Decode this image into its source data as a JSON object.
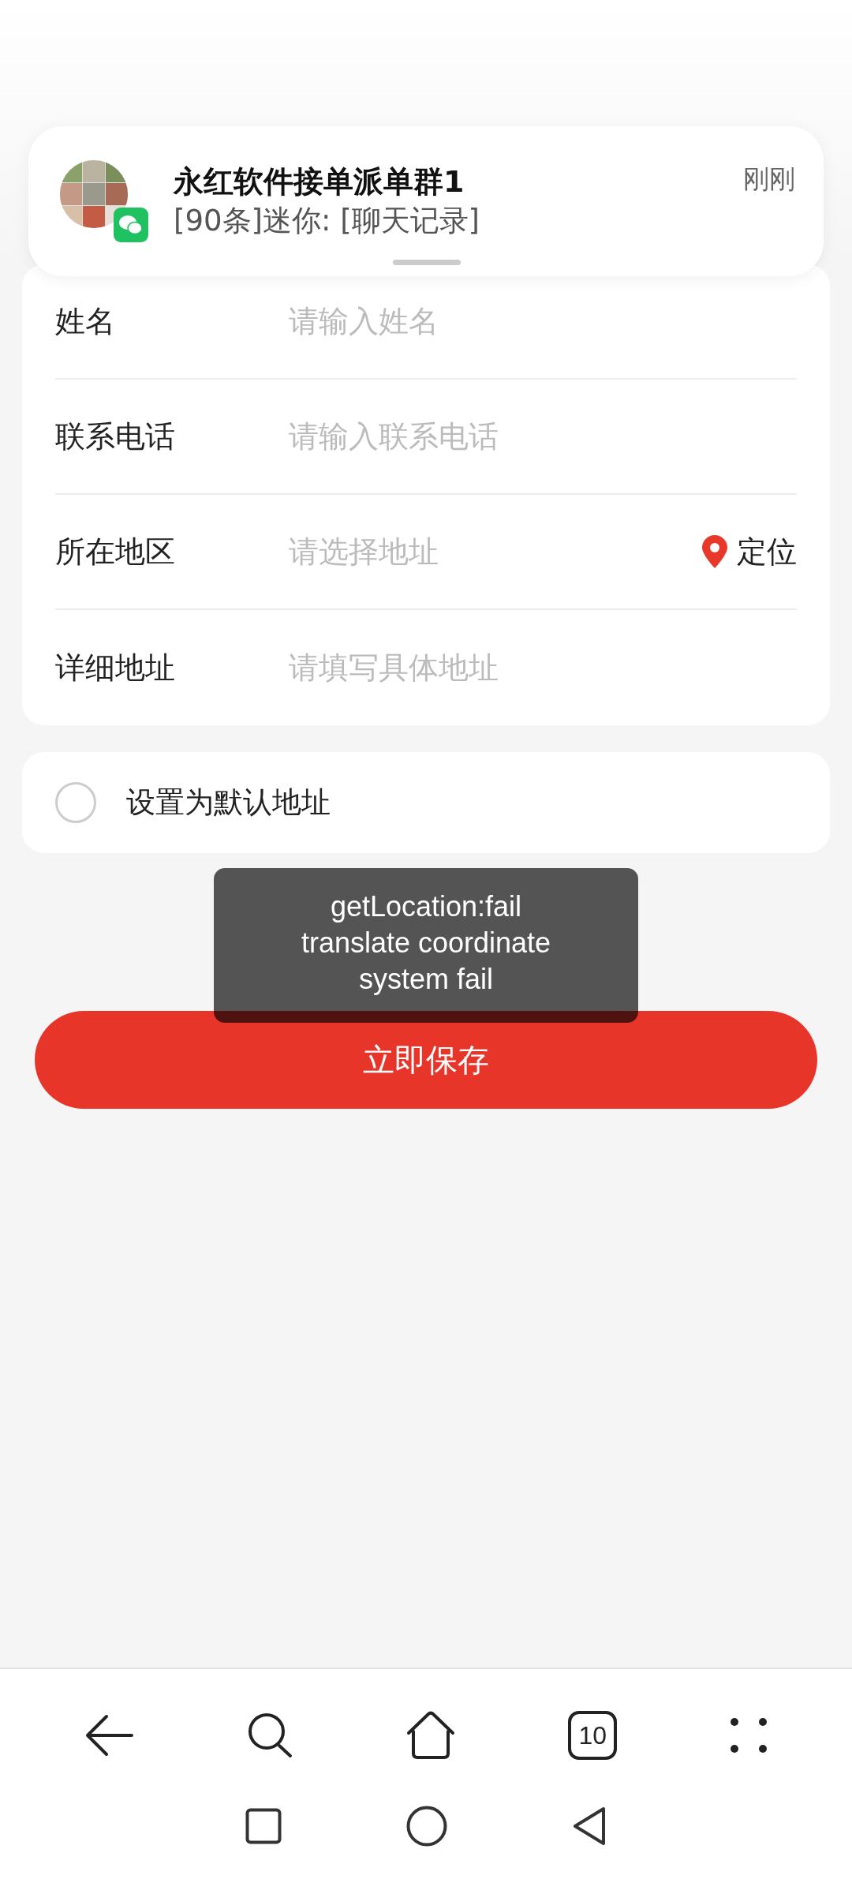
{
  "notification": {
    "title": "永红软件接单派单群1",
    "message": "[90条]迷你: [聊天记录]",
    "time": "刚刚"
  },
  "form": [
    {
      "label": "姓名",
      "placeholder": "请输入姓名"
    },
    {
      "label": "联系电话",
      "placeholder": "请输入联系电话"
    },
    {
      "label": "所在地区",
      "placeholder": "请选择地址",
      "action": "定位"
    },
    {
      "label": "详细地址",
      "placeholder": "请填写具体地址"
    }
  ],
  "default_address": {
    "label": "设置为默认地址",
    "checked": false
  },
  "save_button": {
    "label": "立即保存"
  },
  "toast": {
    "message": "getLocation:fail translate coordinate system fail"
  },
  "browser_bar": {
    "tab_count": "10"
  }
}
